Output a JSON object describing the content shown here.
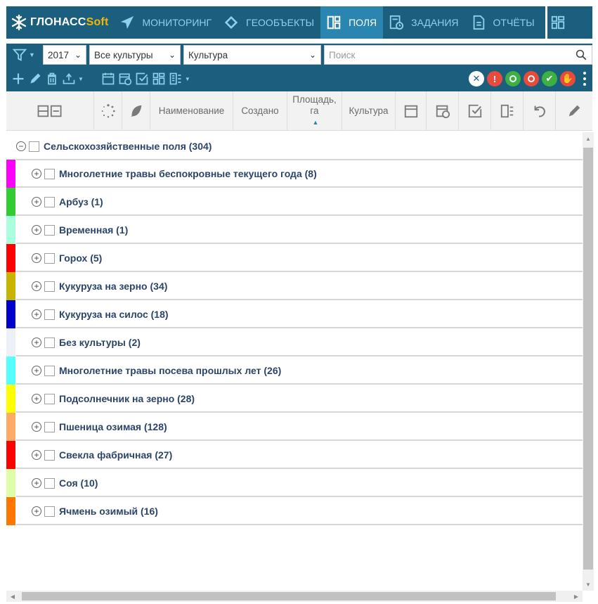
{
  "brand": {
    "name_main": "ГЛОНАСС",
    "name_accent": "Soft"
  },
  "nav": {
    "items": [
      {
        "label": "МОНИТОРИНГ",
        "icon": "send-arrow-icon"
      },
      {
        "label": "ГЕООБЪЕКТЫ",
        "icon": "diamond-icon"
      },
      {
        "label": "ПОЛЯ",
        "icon": "fields-grid-icon",
        "active": true
      },
      {
        "label": "ЗАДАНИЯ",
        "icon": "tasks-clock-icon"
      },
      {
        "label": "ОТЧЁТЫ",
        "icon": "report-doc-icon"
      }
    ]
  },
  "filters": {
    "year": "2017",
    "crops": "Все культуры",
    "group_by": "Культура",
    "search_placeholder": "Поиск"
  },
  "columns": {
    "name": "Наименование",
    "created": "Создано",
    "area": "Площадь, га",
    "crop": "Культура"
  },
  "tree": {
    "root_label": "Сельскохозяйственные поля (304)",
    "groups": [
      {
        "label": "Многолетние травы беспокровные текущего года (8)",
        "color": "#ff00ff"
      },
      {
        "label": "Арбуз (1)",
        "color": "#33cc33"
      },
      {
        "label": "Временная (1)",
        "color": "#aaffdd"
      },
      {
        "label": "Горох (5)",
        "color": "#ff0000"
      },
      {
        "label": "Кукуруза на зерно (34)",
        "color": "#c8b400"
      },
      {
        "label": "Кукуруза на силос (18)",
        "color": "#0000cc"
      },
      {
        "label": "Без культуры (2)",
        "color": "#eef0f8"
      },
      {
        "label": "Многолетние травы посева прошлых лет (26)",
        "color": "#55ffff"
      },
      {
        "label": "Подсолнечник на зерно (28)",
        "color": "#ffff00"
      },
      {
        "label": "Пшеница озимая (128)",
        "color": "#ffaa66"
      },
      {
        "label": "Свекла фабричная (27)",
        "color": "#ff0000"
      },
      {
        "label": "Соя (10)",
        "color": "#ddffaa"
      },
      {
        "label": "Ячмень озимый (16)",
        "color": "#ff7700"
      }
    ]
  },
  "status_colors": {
    "close": "#ffffff",
    "alert": "#e84a3c",
    "eye_green": "#3cb043",
    "eye_red": "#e84a3c",
    "ok": "#3cb043",
    "stop": "#e84a3c"
  }
}
